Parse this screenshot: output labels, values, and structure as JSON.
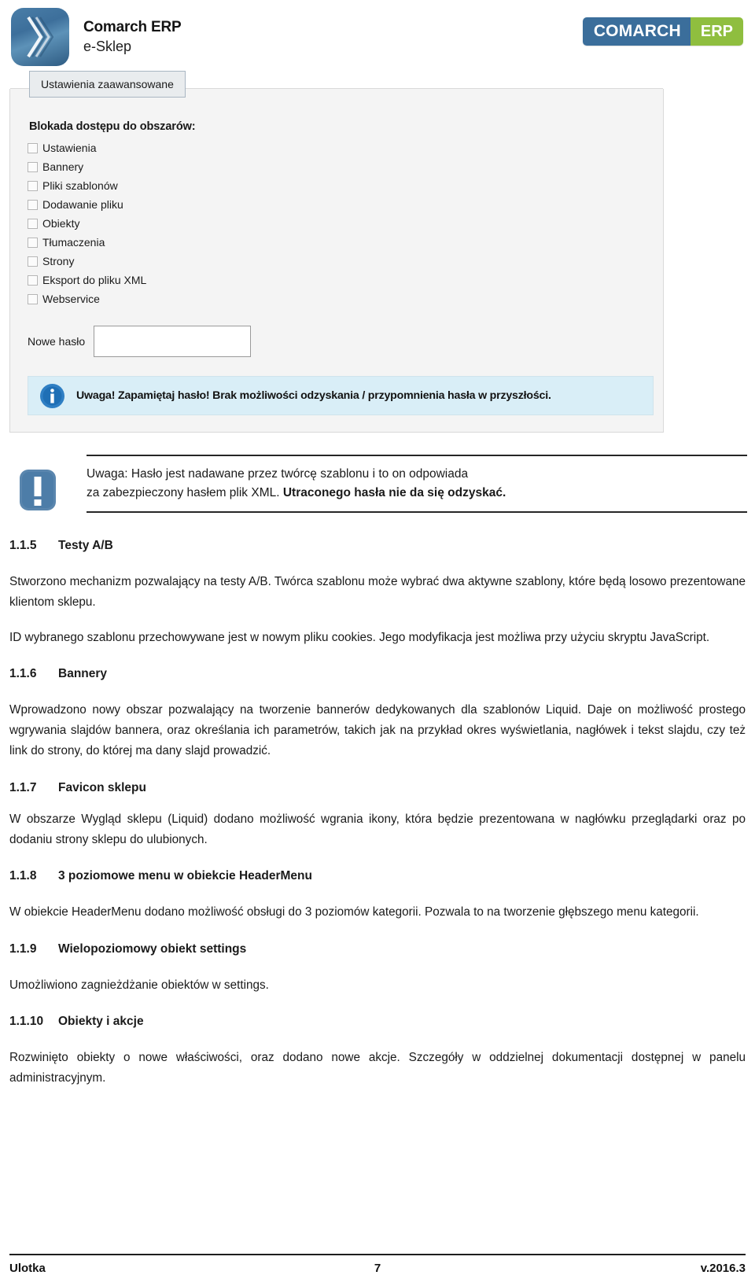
{
  "header": {
    "brand_title": "Comarch ERP",
    "brand_sub": "e-Sklep",
    "brand_icon": "comarch-chevron-logo-icon",
    "corp_left": "COMARCH",
    "corp_right": "ERP"
  },
  "screenshot": {
    "tab_label": "Ustawienia zaawansowane",
    "section_title": "Blokada dostępu do obszarów:",
    "checkboxes": [
      {
        "label": "Ustawienia",
        "checked": false
      },
      {
        "label": "Bannery",
        "checked": false
      },
      {
        "label": "Pliki szablonów",
        "checked": false
      },
      {
        "label": "Dodawanie pliku",
        "checked": false
      },
      {
        "label": "Obiekty",
        "checked": false
      },
      {
        "label": "Tłumaczenia",
        "checked": false
      },
      {
        "label": "Strony",
        "checked": false
      },
      {
        "label": "Eksport do pliku XML",
        "checked": false
      },
      {
        "label": "Webservice",
        "checked": false
      }
    ],
    "password_label": "Nowe hasło",
    "password_value": "",
    "password_placeholder": "",
    "info_icon": "info-circle-icon",
    "info_text": "Uwaga! Zapamiętaj hasło! Brak możliwości odzyskania / przypomnienia hasła w przyszłości."
  },
  "callout": {
    "icon": "exclamation-mark-icon",
    "line1": "Uwaga:  Hasło  jest  nadawane  przez  twórcę  szablonu  i  to  on  odpowiada",
    "line2_plain": "za zabezpieczony hasłem plik XML. ",
    "line2_bold": "Utraconego hasła nie da się odzyskać."
  },
  "sections": [
    {
      "number": "1.1.5",
      "title": "Testy A/B",
      "paragraphs": [
        "Stworzono mechanizm pozwalający na testy A/B. Twórca szablonu może wybrać dwa aktywne szablony, które będą losowo prezentowane klientom sklepu.",
        "ID wybranego szablonu przechowywane jest w nowym pliku cookies. Jego modyfikacja jest możliwa przy użyciu skryptu JavaScript."
      ]
    },
    {
      "number": "1.1.6",
      "title": "Bannery",
      "paragraphs": [
        "Wprowadzono nowy obszar pozwalający na tworzenie bannerów dedykowanych dla szablonów Liquid. Daje on możliwość prostego wgrywania slajdów bannera, oraz określania ich parametrów, takich jak na przykład okres wyświetlania, nagłówek i tekst slajdu, czy też link do strony, do której ma dany slajd prowadzić."
      ]
    },
    {
      "number": "1.1.7",
      "title": "Favicon sklepu",
      "paragraphs": [
        "W obszarze Wygląd sklepu (Liquid) dodano możliwość wgrania ikony, która będzie prezentowana w nagłówku przeglądarki oraz po dodaniu strony sklepu do ulubionych."
      ]
    },
    {
      "number": "1.1.8",
      "title": "3 poziomowe menu w obiekcie HeaderMenu",
      "paragraphs": [
        "W obiekcie HeaderMenu dodano możliwość obsługi do 3 poziomów kategorii. Pozwala to na tworzenie głębszego menu kategorii."
      ]
    },
    {
      "number": "1.1.9",
      "title": "Wielopoziomowy obiekt settings",
      "paragraphs": [
        "Umożliwiono zagnieżdżanie obiektów w settings."
      ]
    },
    {
      "number": "1.1.10",
      "title": "Obiekty i akcje",
      "paragraphs": [
        "Rozwinięto obiekty o nowe właściwości, oraz dodano nowe akcje. Szczegóły w oddzielnej dokumentacji dostępnej w panelu administracyjnym."
      ]
    }
  ],
  "footer": {
    "left": "Ulotka",
    "page": "7",
    "right": "v.2016.3"
  },
  "colors": {
    "brand_blue": "#3b6e9b",
    "brand_green": "#8fbe3f",
    "info_bg": "#d9eef7",
    "panel_bg": "#f4f4f4"
  }
}
